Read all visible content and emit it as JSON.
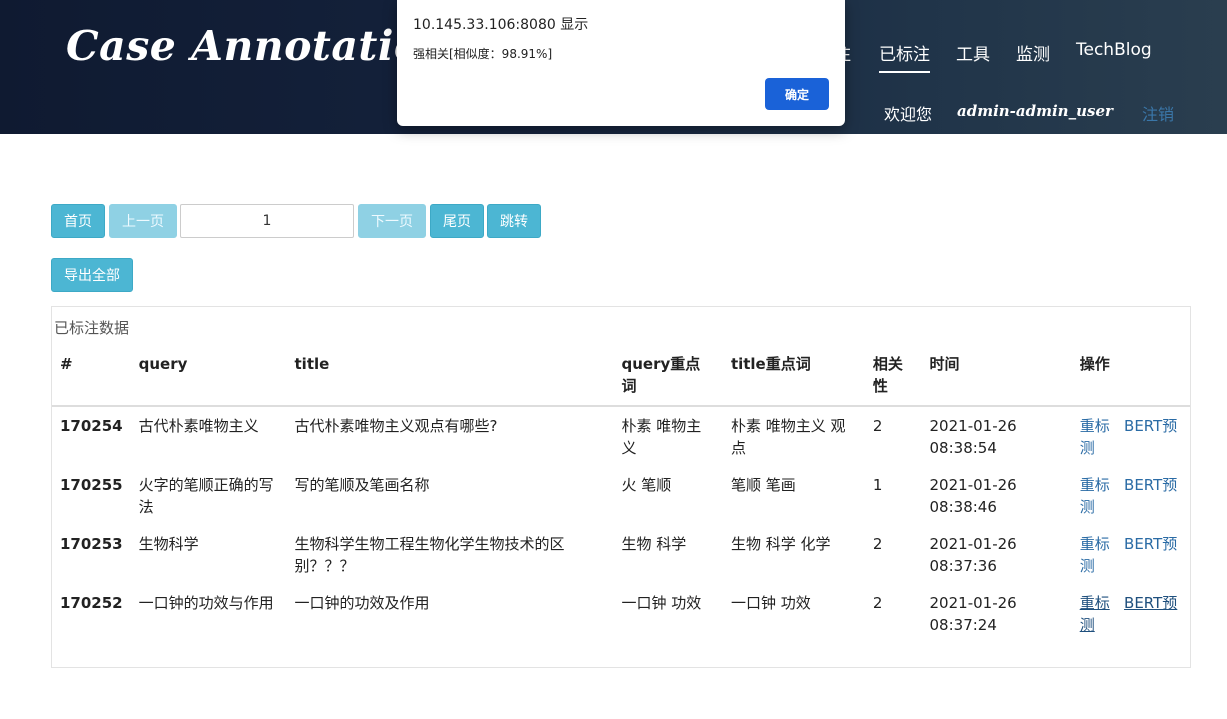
{
  "header": {
    "brand": "Case Annotation",
    "nav": {
      "partial": "注",
      "annotated": "已标注",
      "tools": "工具",
      "monitor": "监测",
      "blog": "TechBlog"
    },
    "welcome": "欢迎您",
    "username": "admin-admin_user",
    "logout": "注销"
  },
  "dialog": {
    "title": "10.145.33.106:8080 显示",
    "message": "强相关[相似度：98.91%]",
    "ok_label": "确定"
  },
  "pager": {
    "first": "首页",
    "prev": "上一页",
    "page_value": "1",
    "next": "下一页",
    "last": "尾页",
    "jump": "跳转",
    "export_all": "导出全部"
  },
  "table": {
    "caption": "已标注数据",
    "headers": [
      "#",
      "query",
      "title",
      "query重点词",
      "title重点词",
      "相关性",
      "时间",
      "操作"
    ],
    "rows": [
      {
        "id": "170254",
        "query": "古代朴素唯物主义",
        "title": "古代朴素唯物主义观点有哪些?",
        "query_kw": "朴素 唯物主义",
        "title_kw": "朴素 唯物主义 观点",
        "relevance": "2",
        "time": "2021-01-26 08:38:54",
        "op1": "重标",
        "op2": "BERT预测"
      },
      {
        "id": "170255",
        "query": "火字的笔顺正确的写法",
        "title": "写的笔顺及笔画名称",
        "query_kw": "火 笔顺",
        "title_kw": "笔顺 笔画",
        "relevance": "1",
        "time": "2021-01-26 08:38:46",
        "op1": "重标",
        "op2": "BERT预测"
      },
      {
        "id": "170253",
        "query": "生物科学",
        "title": "生物科学生物工程生物化学生物技术的区别？？？",
        "query_kw": "生物 科学",
        "title_kw": "生物 科学 化学",
        "relevance": "2",
        "time": "2021-01-26 08:37:36",
        "op1": "重标",
        "op2": "BERT预测"
      },
      {
        "id": "170252",
        "query": "一口钟的功效与作用",
        "title": "一口钟的功效及作用",
        "query_kw": "一口钟 功效",
        "title_kw": "一口钟 功效",
        "relevance": "2",
        "time": "2021-01-26 08:37:24",
        "op1": "重标",
        "op2": "BERT预测"
      }
    ]
  }
}
